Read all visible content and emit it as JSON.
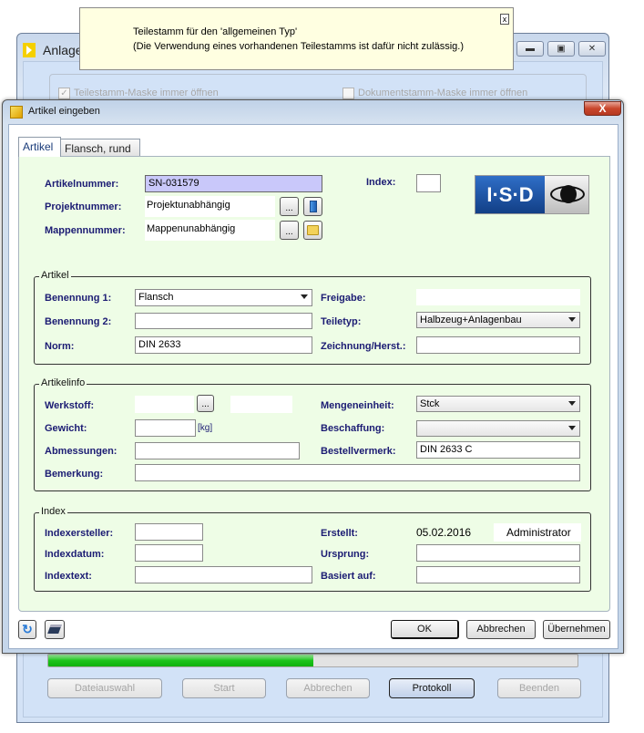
{
  "background_window": {
    "title": "Anlagen",
    "checkbox_teilestamm": {
      "label": "Teilestamm-Maske immer öffnen",
      "checked": true
    },
    "checkbox_dokumentstamm": {
      "label": "Dokumentstamm-Maske immer öffnen",
      "checked": false
    },
    "progress_percent": 50,
    "buttons": {
      "dateiauswahl": "Dateiauswahl",
      "start": "Start",
      "abbrechen": "Abbrechen",
      "protokoll": "Protokoll",
      "beenden": "Beenden"
    }
  },
  "tooltip": {
    "line1": "Teilestamm für den 'allgemeinen Typ'",
    "line2": "(Die Verwendung eines vorhandenen Teilestamms ist dafür nicht zulässig.)",
    "close": "x"
  },
  "dialog": {
    "title": "Artikel eingeben",
    "close": "X",
    "tabs": [
      "Artikel",
      "Flansch, rund"
    ],
    "header": {
      "artikelnummer_label": "Artikelnummer:",
      "artikelnummer": "SN-031579",
      "index_label": "Index:",
      "index": "",
      "projektnummer_label": "Projektnummer:",
      "projektnummer": "Projektunabhängig",
      "mappennummer_label": "Mappennummer:",
      "mappennummer": "Mappenunabhängig",
      "browse": "...",
      "logo": "I·S·D"
    },
    "artikel": {
      "title": "Artikel",
      "benennung1_label": "Benennung 1:",
      "benennung1": "Flansch",
      "benennung2_label": "Benennung 2:",
      "benennung2": "",
      "norm_label": "Norm:",
      "norm": "DIN 2633",
      "freigabe_label": "Freigabe:",
      "freigabe": "",
      "teiletyp_label": "Teiletyp:",
      "teiletyp": "Halbzeug+Anlagenbau",
      "zeichnung_label": "Zeichnung/Herst.:",
      "zeichnung": ""
    },
    "artikelinfo": {
      "title": "Artikelinfo",
      "werkstoff_label": "Werkstoff:",
      "werkstoff": "",
      "gewicht_label": "Gewicht:",
      "gewicht": "",
      "gewicht_unit": "[kg]",
      "abmessungen_label": "Abmessungen:",
      "abmessungen": "",
      "bemerkung_label": "Bemerkung:",
      "bemerkung": "",
      "mengeneinheit_label": "Mengeneinheit:",
      "mengeneinheit": "Stck",
      "beschaffung_label": "Beschaffung:",
      "beschaffung": "",
      "bestellvermerk_label": "Bestellvermerk:",
      "bestellvermerk": "DIN 2633 C"
    },
    "index": {
      "title": "Index",
      "indexersteller_label": "Indexersteller:",
      "indexersteller": "",
      "indexdatum_label": "Indexdatum:",
      "indexdatum": "",
      "indextext_label": "Indextext:",
      "indextext": "",
      "erstellt_label": "Erstellt:",
      "erstellt_datum": "05.02.2016",
      "erstellt_user": "Administrator",
      "ursprung_label": "Ursprung:",
      "ursprung": "",
      "basiert_label": "Basiert auf:",
      "basiert": ""
    },
    "buttons": {
      "ok": "OK",
      "abbrechen": "Abbrechen",
      "uebernehmen": "Übernehmen"
    }
  }
}
